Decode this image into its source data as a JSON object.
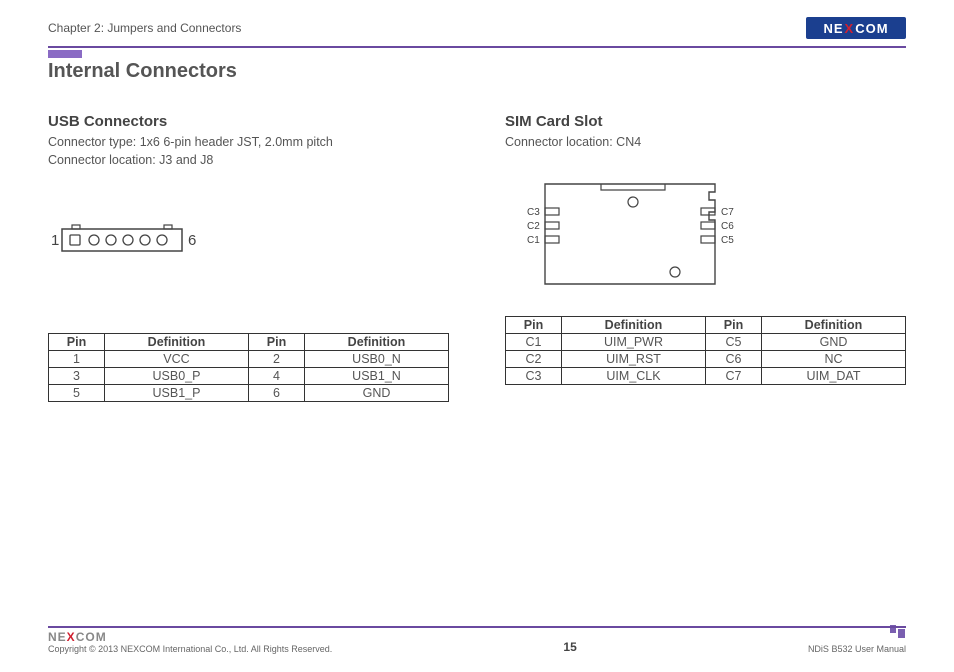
{
  "header": {
    "chapter": "Chapter 2: Jumpers and Connectors",
    "logo": "NEXCOM"
  },
  "main_title": "Internal Connectors",
  "usb": {
    "title": "USB Connectors",
    "desc1": "Connector type: 1x6 6-pin header JST, 2.0mm pitch",
    "desc2": "Connector location: J3 and J8",
    "pin_left_label": "1",
    "pin_right_label": "6",
    "table": {
      "headers": [
        "Pin",
        "Definition",
        "Pin",
        "Definition"
      ],
      "rows": [
        [
          "1",
          "VCC",
          "2",
          "USB0_N"
        ],
        [
          "3",
          "USB0_P",
          "4",
          "USB1_N"
        ],
        [
          "5",
          "USB1_P",
          "6",
          "GND"
        ]
      ]
    }
  },
  "sim": {
    "title": "SIM Card Slot",
    "desc1": "Connector location: CN4",
    "labels": {
      "c1": "C1",
      "c2": "C2",
      "c3": "C3",
      "c5": "C5",
      "c6": "C6",
      "c7": "C7"
    },
    "table": {
      "headers": [
        "Pin",
        "Definition",
        "Pin",
        "Definition"
      ],
      "rows": [
        [
          "C1",
          "UIM_PWR",
          "C5",
          "GND"
        ],
        [
          "C2",
          "UIM_RST",
          "C6",
          "NC"
        ],
        [
          "C3",
          "UIM_CLK",
          "C7",
          "UIM_DAT"
        ]
      ]
    }
  },
  "footer": {
    "copyright": "Copyright © 2013 NEXCOM International Co., Ltd. All Rights Reserved.",
    "page": "15",
    "manual": "NDiS B532 User Manual"
  }
}
